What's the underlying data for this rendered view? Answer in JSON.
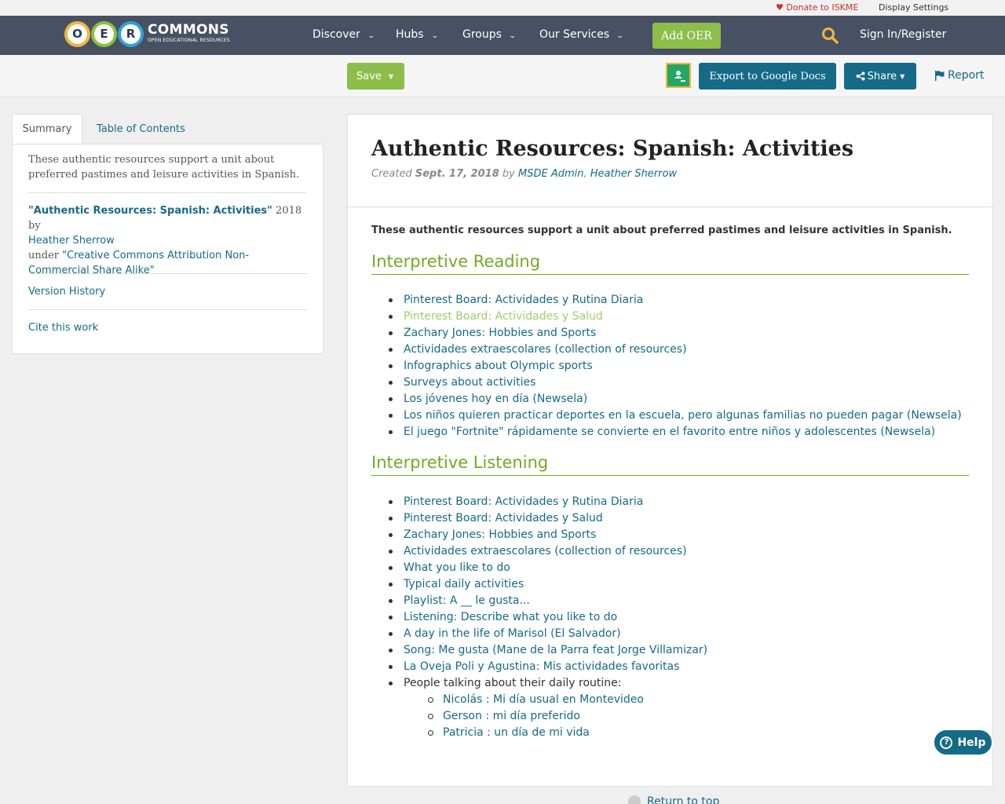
{
  "utility": {
    "donate": "Donate to ISKME",
    "display_settings": "Display Settings"
  },
  "logo": {
    "letters": [
      "O",
      "E",
      "R"
    ],
    "title": "COMMONS",
    "subtitle": "OPEN EDUCATIONAL RESOURCES"
  },
  "nav": {
    "items": [
      "Discover",
      "Hubs",
      "Groups",
      "Our Services"
    ],
    "add_oer": "Add OER",
    "sign_in": "Sign In/Register"
  },
  "toolbar": {
    "save": "Save",
    "export": "Export to Google Docs",
    "share": "Share",
    "report": "Report"
  },
  "sidebar": {
    "tabs": [
      "Summary",
      "Table of Contents"
    ],
    "description": "These authentic resources support a unit about preferred pastimes and leisure activities in Spanish.",
    "attribution": {
      "title": "\"Authentic Resources: Spanish: Activities\"",
      "year_by": " 2018 by",
      "author": "Heather Sherrow",
      "under": "under ",
      "license": "\"Creative Commons Attribution Non-Commercial Share Alike\""
    },
    "version_history": "Version History",
    "cite": "Cite this work"
  },
  "main": {
    "title": "Authentic Resources: Spanish: Activities",
    "created_label": "Created",
    "created_date": "Sept. 17, 2018",
    "by": "by",
    "authors": [
      "MSDE Admin",
      "Heather Sherrow"
    ],
    "summary": "These authentic resources support a unit about preferred pastimes and leisure activities in Spanish.",
    "sections": [
      {
        "title": "Interpretive Reading",
        "items": [
          "Pinterest Board: Actividades y Rutina Diaria",
          "Pinterest Board: Actividades y Salud",
          "Zachary Jones: Hobbies and Sports",
          "Actividades extraescolares (collection of resources)",
          "Infographics about Olympic sports",
          "Surveys about activities",
          "Los jóvenes hoy en día (Newsela)",
          "Los niños quieren practicar deportes en la escuela, pero algunas familias no pueden pagar (Newsela)",
          "El juego \"Fortnite\" rápidamente se convierte en el favorito entre niños y adolescentes (Newsela)"
        ]
      },
      {
        "title": "Interpretive Listening",
        "items": [
          "Pinterest Board: Actividades y Rutina Diaria",
          "Pinterest Board: Actividades y Salud",
          "Zachary Jones: Hobbies and Sports",
          "Actividades extraescolares (collection of resources)",
          "What you like to do",
          "Typical daily activities",
          "Playlist: A __ le gusta...",
          "Listening: Describe what you like to do",
          "A day in the life of Marisol (El Salvador)",
          "Song: Me gusta (Mane de la Parra feat Jorge Villamizar)",
          "La Oveja Poli y Agustina: Mis actividades favoritas",
          "People talking about their daily routine:"
        ],
        "subitems": [
          "Nicolás : Mi día usual en Montevideo",
          "Gerson : mi día preferido",
          "Patricia : un día de mi vida"
        ]
      }
    ]
  },
  "help": "Help",
  "return_to_top": "Return to top",
  "colors": {
    "nav_bg": "#485163",
    "accent_green": "#8dbe4a",
    "link_blue": "#156a87",
    "heading_green": "#74a924"
  }
}
